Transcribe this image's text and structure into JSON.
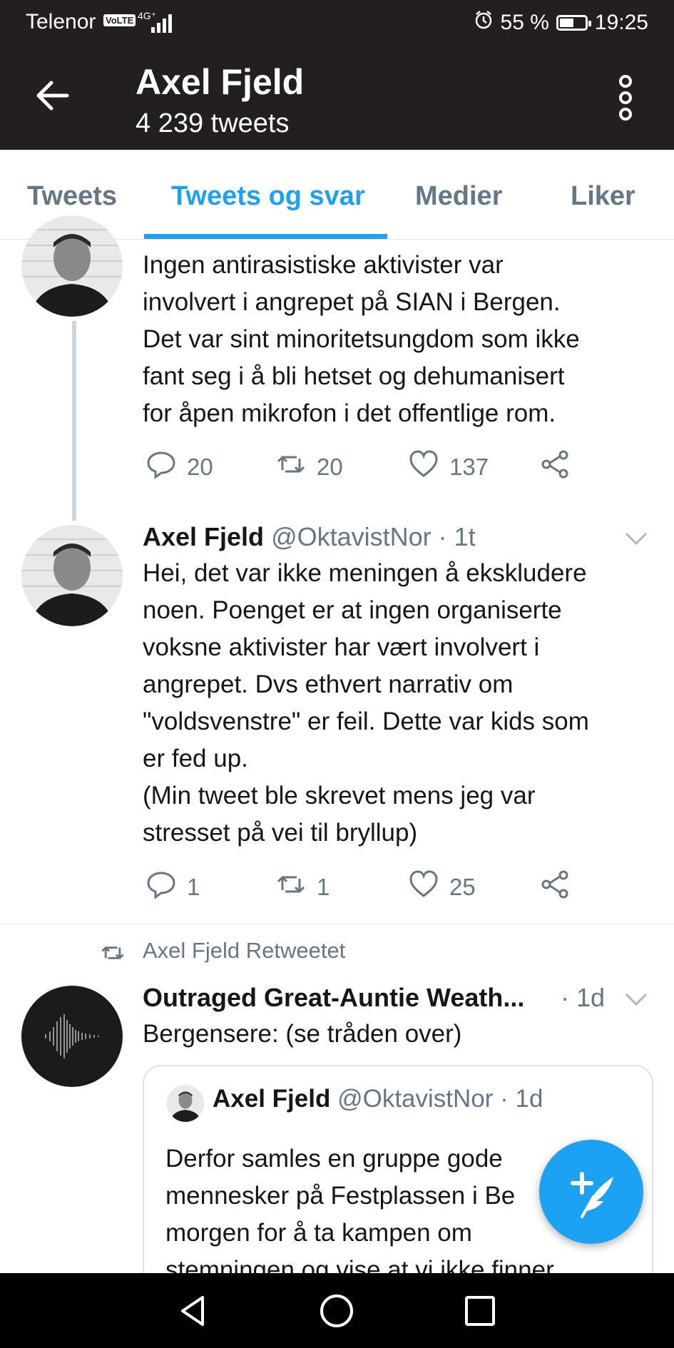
{
  "status": {
    "carrier": "Telenor",
    "volte": "VoLTE",
    "network": "4G⁺",
    "battery_percent": "55 %",
    "battery_level": 0.55,
    "time": "19:25"
  },
  "header": {
    "title": "Axel Fjeld",
    "subtitle": "4 239 tweets"
  },
  "tabs": [
    {
      "label": "Tweets"
    },
    {
      "label": "Tweets og svar",
      "active": true
    },
    {
      "label": "Medier"
    },
    {
      "label": "Liker"
    }
  ],
  "tweets": [
    {
      "text": "Ingen antirasistiske aktivister var\ninvolvert i angrepet på SIAN i Bergen.\nDet var sint minoritetsungdom som ikke\nfant seg i å bli hetset og dehumanisert\nfor åpen mikrofon i det offentlige rom.",
      "replies": "20",
      "retweets": "20",
      "likes": "137"
    },
    {
      "name": "Axel Fjeld",
      "handle": "@OktavistNor · 1t",
      "text": "Hei, det var ikke meningen å ekskludere\nnoen. Poenget er at ingen organiserte\nvoksne aktivister har vært involvert i\nangrepet. Dvs ethvert narrativ om\n\"voldsvenstre\" er feil. Dette var kids som\ner fed up.\n(Min tweet ble skrevet mens jeg var\nstresset på vei til bryllup)",
      "replies": "1",
      "retweets": "1",
      "likes": "25"
    },
    {
      "retweet_label": "Axel Fjeld Retweetet",
      "name": "Outraged Great-Auntie Weath...",
      "time": "· 1d",
      "text": "Bergensere: (se tråden over)",
      "quote": {
        "name": "Axel Fjeld",
        "handle": "@OktavistNor · 1d",
        "text": "Derfor samles en gruppe gode\nmennesker på Festplassen i Be\nmorgen for å ta kampen om\nstemningen og vise at vi ikke finner"
      }
    }
  ],
  "colors": {
    "accent": "#1da1f2",
    "header_bg": "#231f1e",
    "muted": "#657786"
  }
}
